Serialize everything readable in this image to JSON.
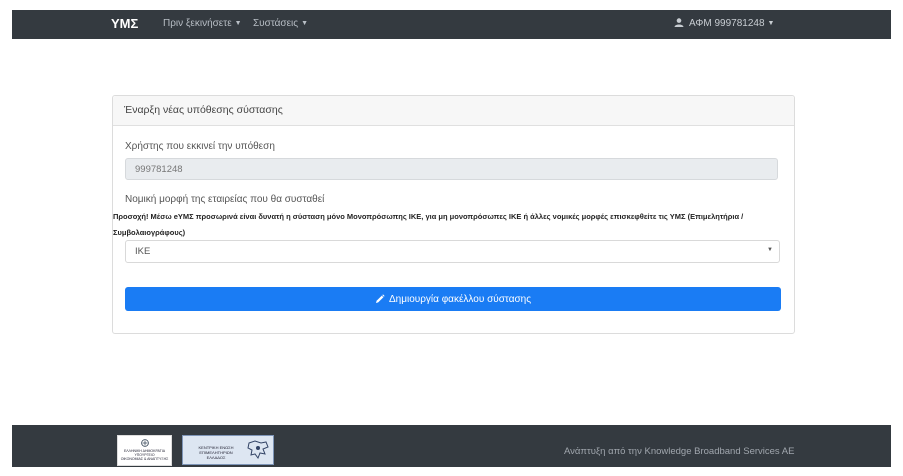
{
  "navbar": {
    "brand": "ΥΜΣ",
    "menu1": "Πριν ξεκινήσετε",
    "menu2": "Συστάσεις",
    "user": "ΑΦΜ 999781248"
  },
  "card": {
    "title": "Έναρξη νέας υπόθεσης σύστασης",
    "user_label": "Χρήστης που εκκινεί την υπόθεση",
    "user_value": "999781248",
    "legal_label": "Νομική μορφή της εταιρείας που θα συσταθεί",
    "warning": "Προσοχή! Μέσω eΥΜΣ προσωρινά είναι δυνατή η σύσταση μόνο Μονοπρόσωπης ΙΚΕ, για μη μονοπρόσωπες ΙΚΕ ή άλλες νομικές μορφές επισκεφθείτε τις ΥΜΣ (Επιμελητήρια / Συμβολαιογράφους)",
    "select_value": "ΙΚΕ",
    "button_label": "Δημιουργία φακέλλου σύστασης"
  },
  "footer": {
    "credit": "Ανάπτυξη από την Knowledge Broadband Services AE",
    "logo1_text": "ΕΛΛΗΝΙΚΗ ΔΗΜΟΚΡΑΤΙΑ ΥΠΟΥΡΓΕΙΟ ΟΙΚΟΝΟΜΙΑΣ & ΑΝΑΠΤΥΞΗΣ",
    "logo2_text": "ΚΕΝΤΡΙΚΗ ΕΝΩΣΗ ΕΠΙΜΕΛΗΤΗΡΙΩΝ ΕΛΛΑΔΟΣ"
  },
  "colors": {
    "navbar": "#343a40",
    "primary": "#1a7cf4"
  }
}
